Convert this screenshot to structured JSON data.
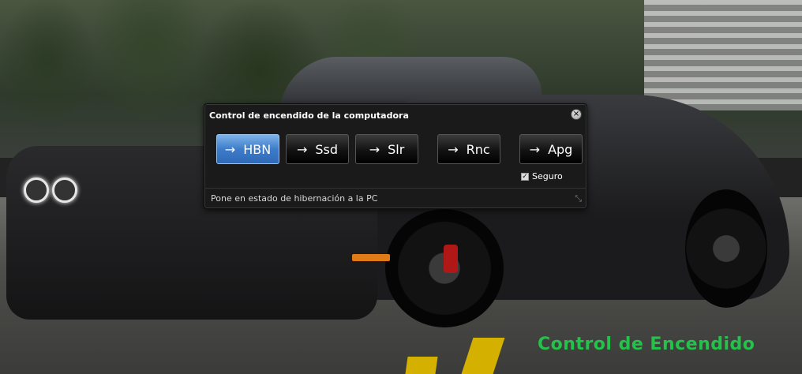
{
  "widget": {
    "title": "Control de encendido de la computadora",
    "close_icon": "close-icon",
    "buttons": [
      {
        "id": "hbn",
        "arrow": "→",
        "label": "HBN",
        "active": true
      },
      {
        "id": "ssd",
        "arrow": "→",
        "label": "Ssd",
        "active": false
      },
      {
        "id": "slr",
        "arrow": "→",
        "label": "Slr",
        "active": false
      },
      {
        "id": "rnc",
        "arrow": "→",
        "label": "Rnc",
        "active": false
      },
      {
        "id": "apg",
        "arrow": "→",
        "label": "Apg",
        "active": false
      }
    ],
    "safe_checkbox": {
      "label": "Seguro",
      "checked": true
    },
    "status": "Pone en estado de hibernación a la PC",
    "resize_icon": "resize-grip-icon"
  },
  "watermark": "Control de Encendido",
  "colors": {
    "active_button": "#3d7cc9",
    "watermark": "#24c24a",
    "widget_bg": "#1a1a1a"
  }
}
